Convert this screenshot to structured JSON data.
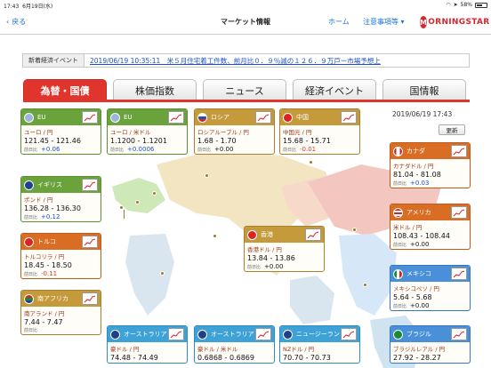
{
  "status": {
    "time": "17:43",
    "date": "6月19日(水)",
    "battery": "58%"
  },
  "nav": {
    "back": "戻る",
    "title": "マーケット情報",
    "home": "ホーム",
    "notes": "注意事項等",
    "logo": "MORNINGSTAR"
  },
  "event": {
    "label": "新着経済イベント",
    "text": "2019/06/19 10:35:11　米５月住宅着工件数、前月比０．９％減の１２６．９万戸ー市場予想上"
  },
  "tabs": [
    "為替・国債",
    "株価指数",
    "ニュース",
    "経済イベント",
    "国情報"
  ],
  "date": "2019/06/19 17:43",
  "refresh": "更新",
  "change_label": "前日比",
  "cards": [
    {
      "name": "EU",
      "pair": "ユーロ / 円",
      "price": "121.45 - 121.46",
      "change": "+0.06"
    },
    {
      "name": "EU",
      "pair": "ユーロ / 米ドル",
      "price": "1.1200 - 1.1201",
      "change": "+0.0006"
    },
    {
      "name": "ロシア",
      "pair": "ロシアルーブル / 円",
      "price": "1.68 - 1.70",
      "change": "+0.00"
    },
    {
      "name": "中国",
      "pair": "中国元 / 円",
      "price": "15.68 - 15.71",
      "change": "-0.01"
    },
    {
      "name": "カナダ",
      "pair": "カナダドル / 円",
      "price": "81.04 - 81.08",
      "change": "+0.03"
    },
    {
      "name": "イギリス",
      "pair": "ポンド / 円",
      "price": "136.28 - 136.30",
      "change": "+0.12"
    },
    {
      "name": "アメリカ",
      "pair": "米ドル / 円",
      "price": "108.43 - 108.44",
      "change": "+0.00"
    },
    {
      "name": "トルコ",
      "pair": "トルコリラ / 円",
      "price": "18.45 - 18.50",
      "change": "-0.11"
    },
    {
      "name": "香港",
      "pair": "香港ドル / 円",
      "price": "13.84 - 13.86",
      "change": "+0.00"
    },
    {
      "name": "メキシコ",
      "pair": "メキシコペソ / 円",
      "price": "5.64 - 5.68",
      "change": "+0.00"
    },
    {
      "name": "南アフリカ",
      "pair": "南アランド / 円",
      "price": "7.44 - 7.47",
      "change": ""
    },
    {
      "name": "オーストラリア",
      "pair": "豪ドル / 円",
      "price": "74.48 - 74.49",
      "change": ""
    },
    {
      "name": "オーストラリア",
      "pair": "豪ドル / 米ドル",
      "price": "0.6868 - 0.6869",
      "change": ""
    },
    {
      "name": "ニュージーランド",
      "pair": "NZドル / 円",
      "price": "70.70 - 70.73",
      "change": ""
    },
    {
      "name": "ブラジル",
      "pair": "ブラジルレアル / 円",
      "price": "27.92 - 28.27",
      "change": ""
    }
  ]
}
